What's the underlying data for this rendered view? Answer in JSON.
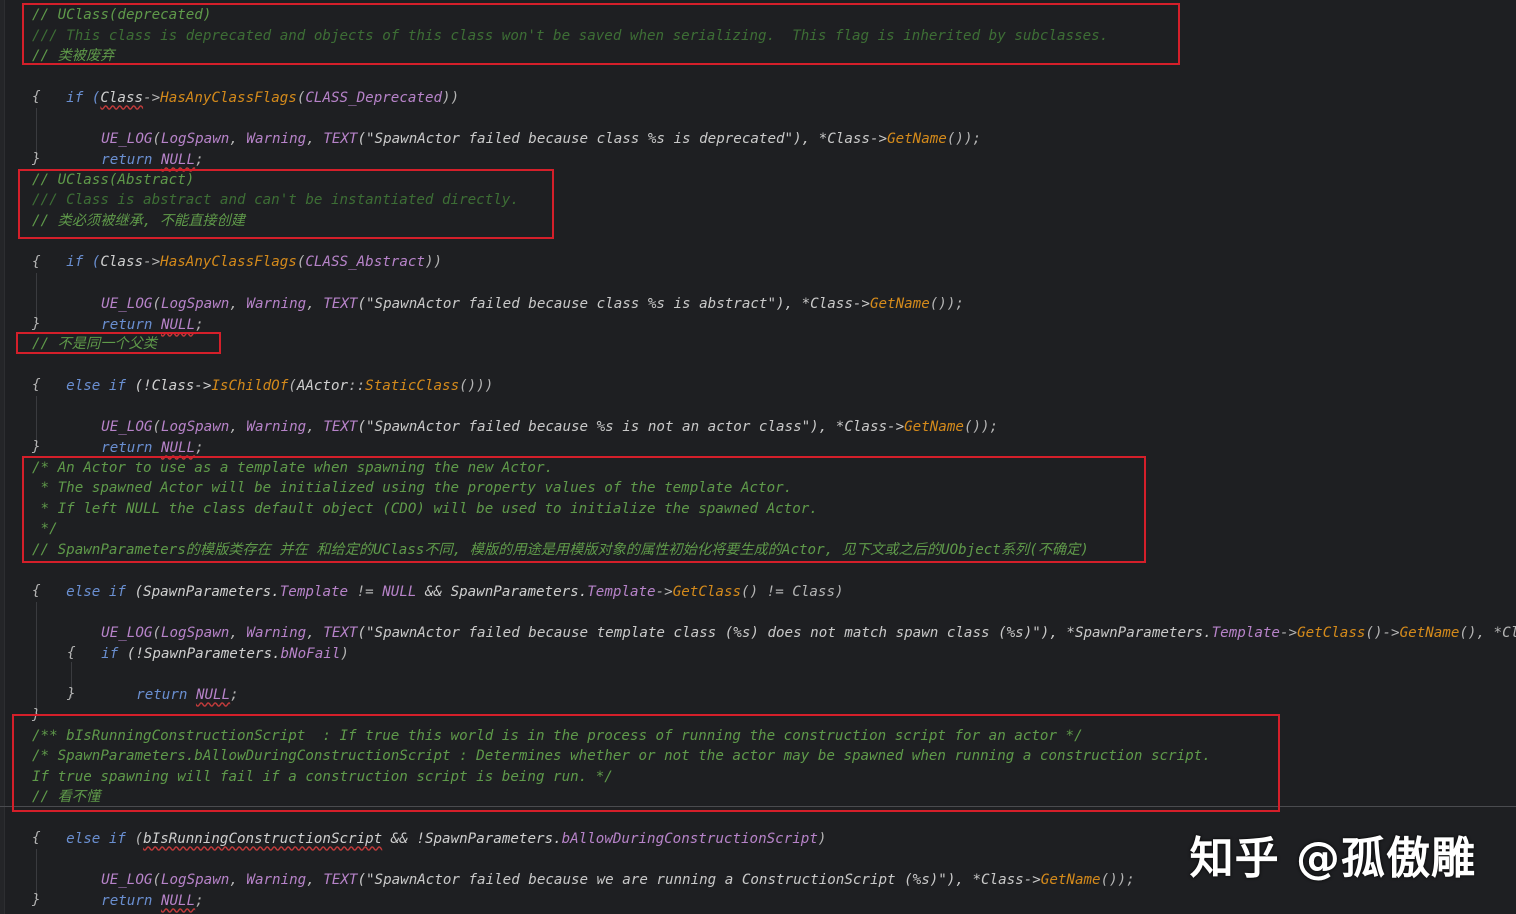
{
  "code": {
    "l01": "// UClass(deprecated)",
    "l02": "/// This class is deprecated and objects of this class won't be saved when serializing.  This flag is inherited by subclasses.",
    "l03": "// 类被废弃",
    "l04a": "if (",
    "l04b": "Class",
    "l04c": "->",
    "l04d": "HasAnyClassFlags",
    "l04e": "(",
    "l04f": "CLASS_Deprecated",
    "l04g": "))",
    "l05": "{",
    "l06a": "UE_LOG",
    "l06b": "(",
    "l06c": "LogSpawn",
    "l06d": ", ",
    "l06e": "Warning",
    "l06f": ", ",
    "l06g": "TEXT",
    "l06h": "(\"SpawnActor failed because class %s is deprecated\"), *Class->",
    "l06i": "GetName",
    "l06j": "());",
    "l07a": "return ",
    "l07b": "NULL",
    "l07c": ";",
    "l08": "}",
    "l09": "// UClass(Abstract)",
    "l10": "/// Class is abstract and can't be instantiated directly.",
    "l11": "// 类必须被继承, 不能直接创建",
    "l12a": "if (",
    "l12b": "Class",
    "l12c": "->",
    "l12d": "HasAnyClassFlags",
    "l12e": "(",
    "l12f": "CLASS_Abstract",
    "l12g": "))",
    "l13": "{",
    "l14a": "UE_LOG",
    "l14b": "(",
    "l14c": "LogSpawn",
    "l14d": ", ",
    "l14e": "Warning",
    "l14f": ", ",
    "l14g": "TEXT",
    "l14h": "(\"SpawnActor failed because class %s is abstract\"), *Class->",
    "l14i": "GetName",
    "l14j": "());",
    "l15a": "return ",
    "l15b": "NULL",
    "l15c": ";",
    "l16": "}",
    "l17": "// 不是同一个父类",
    "l18a": "else if ",
    "l18b": "(!Class->",
    "l18c": "IsChildOf",
    "l18d": "(",
    "l18e": "AActor",
    "l18f": "::",
    "l18g": "StaticClass",
    "l18h": "()))",
    "l19": "{",
    "l20a": "UE_LOG",
    "l20b": "(",
    "l20c": "LogSpawn",
    "l20d": ", ",
    "l20e": "Warning",
    "l20f": ", ",
    "l20g": "TEXT",
    "l20h": "(\"SpawnActor failed because %s is not an actor class\"), *Class->",
    "l20i": "GetName",
    "l20j": "());",
    "l21a": "return ",
    "l21b": "NULL",
    "l21c": ";",
    "l22": "}",
    "l23": "/* An Actor to use as a template when spawning the new Actor.",
    "l24": " * The spawned Actor will be initialized using the property values of the template Actor.",
    "l25": " * If left NULL the class default object (CDO) will be used to initialize the spawned Actor.",
    "l26": " */",
    "l27": "// SpawnParameters的模版类存在 并在 和给定的UClass不同, 模版的用途是用模版对象的属性初始化将要生成的Actor, 见下文或之后的UObject系列(不确定)",
    "l28a": "else if ",
    "l28b": "(SpawnParameters.",
    "l28c": "Template",
    "l28d": " != ",
    "l28e": "NULL",
    "l28f": " && SpawnParameters.",
    "l28g": "Template",
    "l28h": "->",
    "l28i": "GetClass",
    "l28j": "() != Class)",
    "l29": "{",
    "l30a": "UE_LOG",
    "l30b": "(",
    "l30c": "LogSpawn",
    "l30d": ", ",
    "l30e": "Warning",
    "l30f": ", ",
    "l30g": "TEXT",
    "l30h": "(\"SpawnActor failed because template class (%s) does not match spawn class (%s)\"), *SpawnParameters.",
    "l30i": "Template",
    "l30j": "->",
    "l30k": "GetClass",
    "l30l": "()->",
    "l30m": "GetName",
    "l30n": "(), *Cla",
    "l31a": "if ",
    "l31b": "(!SpawnParameters.",
    "l31c": "bNoFail",
    "l31d": ")",
    "l32": "{",
    "l33a": "return ",
    "l33b": "NULL",
    "l33c": ";",
    "l34": "}",
    "l35": "}",
    "l36": "/** bIsRunningConstructionScript  : If true this world is in the process of running the construction script for an actor */",
    "l37": "/* SpawnParameters.bAllowDuringConstructionScript : Determines whether or not the actor may be spawned when running a construction script.",
    "l38": "If true spawning will fail if a construction script is being run. */",
    "l39": "// 看不懂",
    "l40a": "else if ",
    "l40b": "(",
    "l40c": "bIsRunningConstructionScript",
    "l40d": " && !SpawnParameters.",
    "l40e": "bAllowDuringConstructionScript",
    "l40f": ")",
    "l41": "{",
    "l42a": "UE_LOG",
    "l42b": "(",
    "l42c": "LogSpawn",
    "l42d": ", ",
    "l42e": "Warning",
    "l42f": ", ",
    "l42g": "TEXT",
    "l42h": "(\"SpawnActor failed because we are running a ConstructionScript (%s)\"), *Class->",
    "l42i": "GetName",
    "l42j": "());",
    "l43a": "return ",
    "l43b": "NULL",
    "l43c": ";",
    "l44": "}"
  },
  "watermark": "知乎 @孤傲雕",
  "colors": {
    "background": "#1e1f22",
    "comment": "#5f9a4a",
    "keyword": "#6a8fd1",
    "function": "#d48a1b",
    "macro": "#b783c9",
    "annotation_box": "#d41f2a"
  }
}
